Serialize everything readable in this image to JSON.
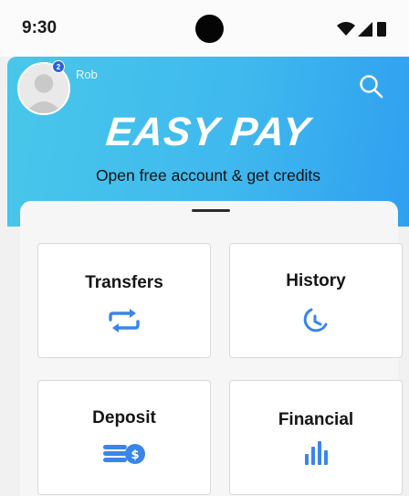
{
  "status_bar": {
    "time": "9:30",
    "icons": [
      "wifi-icon",
      "signal-icon",
      "battery-icon"
    ]
  },
  "header": {
    "user_name": "Rob",
    "avatar_badge": "2",
    "brand": "EASY PAY",
    "tagline": "Open free account & get credits",
    "search_icon": "search-icon",
    "gradient_colors": [
      "#49c7ea",
      "#2f9ff0"
    ]
  },
  "tiles": [
    {
      "label": "Transfers",
      "icon": "transfer-arrows-icon"
    },
    {
      "label": "History",
      "icon": "history-clock-icon"
    },
    {
      "label": "Deposit",
      "icon": "coins-dollar-icon"
    },
    {
      "label": "Financial",
      "icon": "bar-chart-icon"
    }
  ],
  "colors": {
    "accent": "#3a86e8",
    "text": "#151515"
  }
}
